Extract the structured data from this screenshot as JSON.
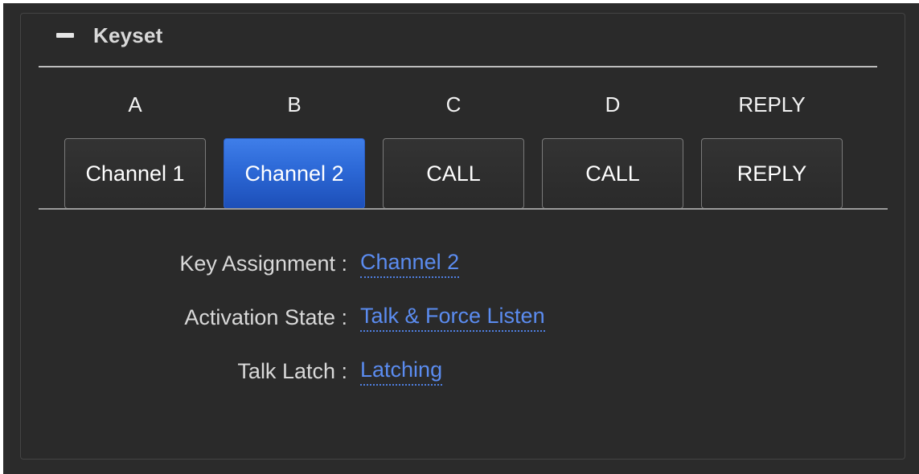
{
  "panel": {
    "title": "Keyset",
    "collapse_icon": "minus-icon"
  },
  "keys": [
    {
      "letter": "A",
      "label": "Channel 1",
      "active": false
    },
    {
      "letter": "B",
      "label": "Channel 2",
      "active": true
    },
    {
      "letter": "C",
      "label": "CALL",
      "active": false
    },
    {
      "letter": "D",
      "label": "CALL",
      "active": false
    },
    {
      "letter": "REPLY",
      "label": "REPLY",
      "active": false
    }
  ],
  "properties": {
    "key_assignment": {
      "label": "Key Assignment :",
      "value": "Channel 2"
    },
    "activation_state": {
      "label": "Activation State :",
      "value": "Talk & Force Listen"
    },
    "talk_latch": {
      "label": "Talk Latch :",
      "value": "Latching"
    }
  },
  "colors": {
    "background": "#2b2b2b",
    "active_button": "#2c68d6",
    "link": "#5b8cf0",
    "text": "#f2f2f2"
  }
}
